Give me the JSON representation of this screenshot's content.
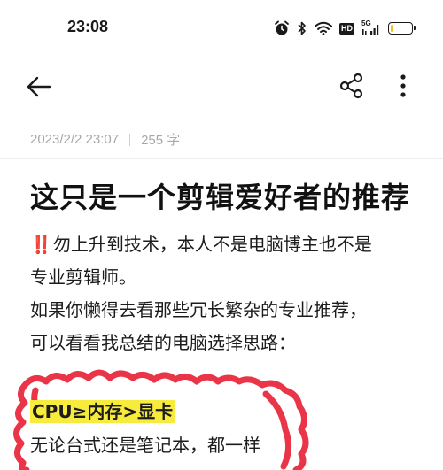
{
  "status_bar": {
    "time": "23:08",
    "network_label": "5G",
    "hd_label": "HD",
    "battery_level": 0.15,
    "battery_color": "#f2c21b"
  },
  "app_bar": {
    "back_icon": "arrow-left-icon",
    "share_icon": "share-icon",
    "more_icon": "more-vertical-icon"
  },
  "note": {
    "date": "2023/2/2 23:07",
    "word_count": "255 字",
    "title": "这只是一个剪辑爱好者的推荐",
    "warning_mark": "‼️",
    "lines": [
      "勿上升到技术，本人不是电脑博主也不是",
      "专业剪辑师。",
      "如果你懒得去看那些冗长繁杂的专业推荐，",
      "可以看看我总结的电脑选择思路："
    ],
    "highlight": "CPU≥内存>显卡",
    "last_line": "无论台式还是笔记本，都一样"
  },
  "colors": {
    "scribble": "#e8243a",
    "highlight": "#f7ec3d",
    "meta_text": "#a8a8a8"
  }
}
